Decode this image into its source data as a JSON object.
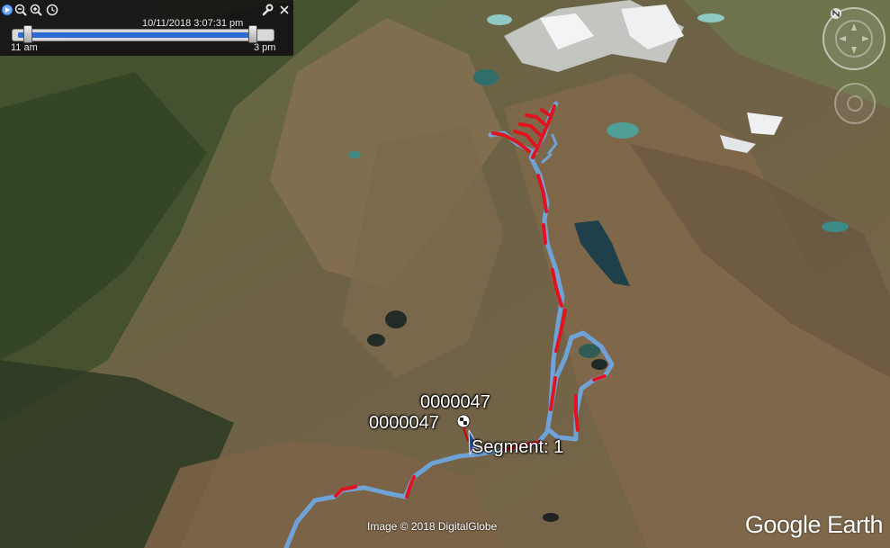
{
  "timebar": {
    "date_time": "10/11/2018   3:07:31 pm",
    "start_label": "11 am",
    "end_label": "3 pm"
  },
  "placemarks": {
    "label_top": "0000047",
    "label_left": "0000047",
    "segment_label": "Segment: 1"
  },
  "footer": {
    "credit": "Image © 2018 DigitalGlobe",
    "logo": "Google Earth"
  },
  "colors": {
    "track_blue": "#6fa3d8",
    "track_red": "#e0141e",
    "lake": "#3d8a86"
  },
  "icons": [
    "play-icon",
    "zoom-out-icon",
    "zoom-in-icon",
    "clock-icon",
    "wrench-icon",
    "close-icon",
    "compass-icon",
    "look-around-icon",
    "checkered-flag-icon",
    "arrow-marker-icon"
  ]
}
